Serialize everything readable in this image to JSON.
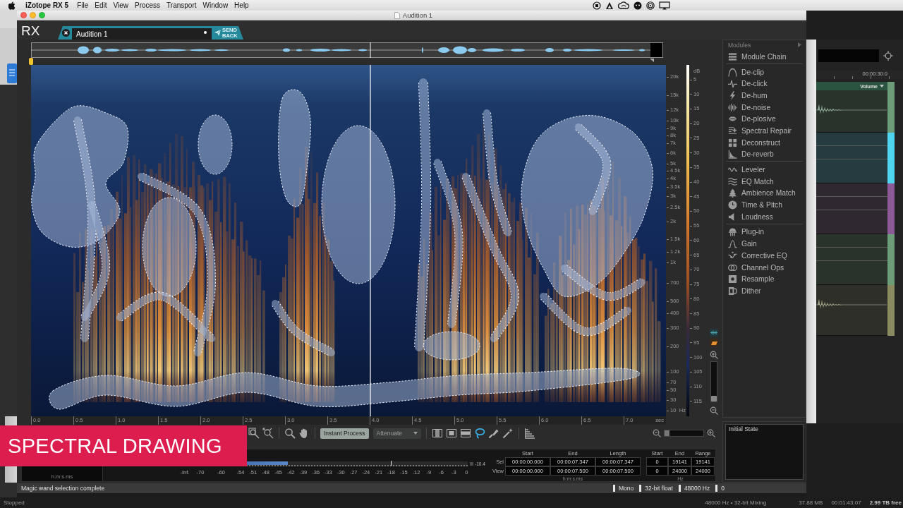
{
  "menu_bar": {
    "app_name": "iZotope RX 5",
    "menus": [
      "File",
      "Edit",
      "View",
      "Process",
      "Transport",
      "Window",
      "Help"
    ]
  },
  "window": {
    "title": "Audition 1"
  },
  "header": {
    "logo": "RX",
    "tab": {
      "label": "Audition 1",
      "selected": true,
      "modified": true
    },
    "send_back": "SEND BACK"
  },
  "spectrogram": {
    "frequency_labels": [
      "20k",
      "15k",
      "12k",
      "10k",
      "9k",
      "8k",
      "7k",
      "6k",
      "5k",
      "4.5k",
      "4k",
      "3.5k",
      "3k",
      "2.5k",
      "2k",
      "1.5k",
      "1.2k",
      "1k",
      "700",
      "500",
      "400",
      "300",
      "200",
      "100",
      "70",
      "50",
      "30",
      "10"
    ],
    "frequency_unit": "Hz",
    "db_unit": "dB",
    "db_labels": [
      "5",
      "10",
      "15",
      "20",
      "25",
      "30",
      "35",
      "40",
      "45",
      "50",
      "55",
      "60",
      "65",
      "70",
      "75",
      "80",
      "85",
      "90",
      "95",
      "100",
      "105",
      "110",
      "115"
    ],
    "time_labels": [
      "0.0",
      "0.5",
      "1.0",
      "1.5",
      "2.0",
      "2.5",
      "3.0",
      "3.5",
      "4.0",
      "4.5",
      "5.0",
      "5.5",
      "6.0",
      "6.5",
      "7.0"
    ],
    "time_unit": "sec",
    "vertical_zoom": {
      "level": 0
    }
  },
  "toolbar": {
    "instant_process": "Instant Process",
    "mode": {
      "value": "Attenuate",
      "disabled": true
    },
    "tools": [
      {
        "selected": false
      },
      {
        "selected": false
      },
      {
        "selected": false
      },
      {
        "selected": true
      },
      {
        "selected": false
      },
      {
        "selected": false
      }
    ],
    "zoom": {
      "level": 0
    }
  },
  "bottom_panel": {
    "time_display": {
      "unit": "h:m:s.ms"
    },
    "meter": {
      "scale": [
        "-Inf.",
        "-70",
        "-60",
        "-54",
        "-51",
        "-48",
        "-45",
        "-42",
        "-39",
        "-36",
        "-33",
        "-30",
        "-27",
        "-24",
        "-21",
        "-18",
        "-15",
        "-12",
        "-9",
        "-6",
        "-3",
        "0"
      ],
      "level": 0.37,
      "peak_hold": {
        "level": 0.73
      },
      "reading": "-10.4"
    },
    "selection": {
      "columns": [
        "Start",
        "End",
        "Length"
      ],
      "rows": [
        {
          "label": "Sel",
          "cells": [
            "00:00:00.000",
            "00:00:07.347",
            "00:00:07.347"
          ]
        },
        {
          "label": "View",
          "cells": [
            "00:00:00.000",
            "00:00:07.500",
            "00:00:07.500"
          ]
        }
      ],
      "unit": "h:m:s.ms"
    },
    "frequency": {
      "columns": [
        "Start",
        "End",
        "Range"
      ],
      "rows": [
        [
          "0",
          "19141",
          "19141"
        ],
        [
          "0",
          "24000",
          "24000"
        ]
      ],
      "unit": "Hz"
    }
  },
  "status_bar": {
    "message": "Magic wand selection complete",
    "items": [
      "Mono",
      "32-bit float",
      "48000 Hz",
      "0"
    ]
  },
  "modules": {
    "title": "Modules",
    "groups": [
      {
        "items": [
          "Module Chain"
        ]
      },
      {
        "items": [
          "De-clip",
          "De-click",
          "De-hum",
          "De-noise",
          "De-plosive",
          "Spectral Repair",
          "Deconstruct",
          "De-reverb"
        ]
      },
      {
        "items": [
          "Leveler",
          "EQ Match",
          "Ambience Match",
          "Time & Pitch",
          "Loudness"
        ]
      },
      {
        "items": [
          "Plug-in",
          "Gain",
          "Corrective EQ",
          "Channel Ops",
          "Resample",
          "Dither"
        ]
      }
    ]
  },
  "history": {
    "items": [
      "Initial State"
    ]
  },
  "caption": "SPECTRAL DRAWING",
  "background_app": {
    "timecode": "00:00:30:0",
    "track_header": "Volume",
    "tracks": [
      {
        "kind": "audio",
        "color": "#6c9c78"
      },
      {
        "kind": "empty",
        "color": "#4fd6ee"
      },
      {
        "kind": "empty",
        "color": "#8c5a96"
      },
      {
        "kind": "empty",
        "color": "#6c9c78"
      },
      {
        "kind": "audio",
        "color": "#8a8a60"
      }
    ],
    "status": "Stopped",
    "status_items": [
      "48000 Hz • 32-bit Mixing",
      "37.88 MB",
      "00:01:43:07",
      "2.99 TB free"
    ]
  }
}
